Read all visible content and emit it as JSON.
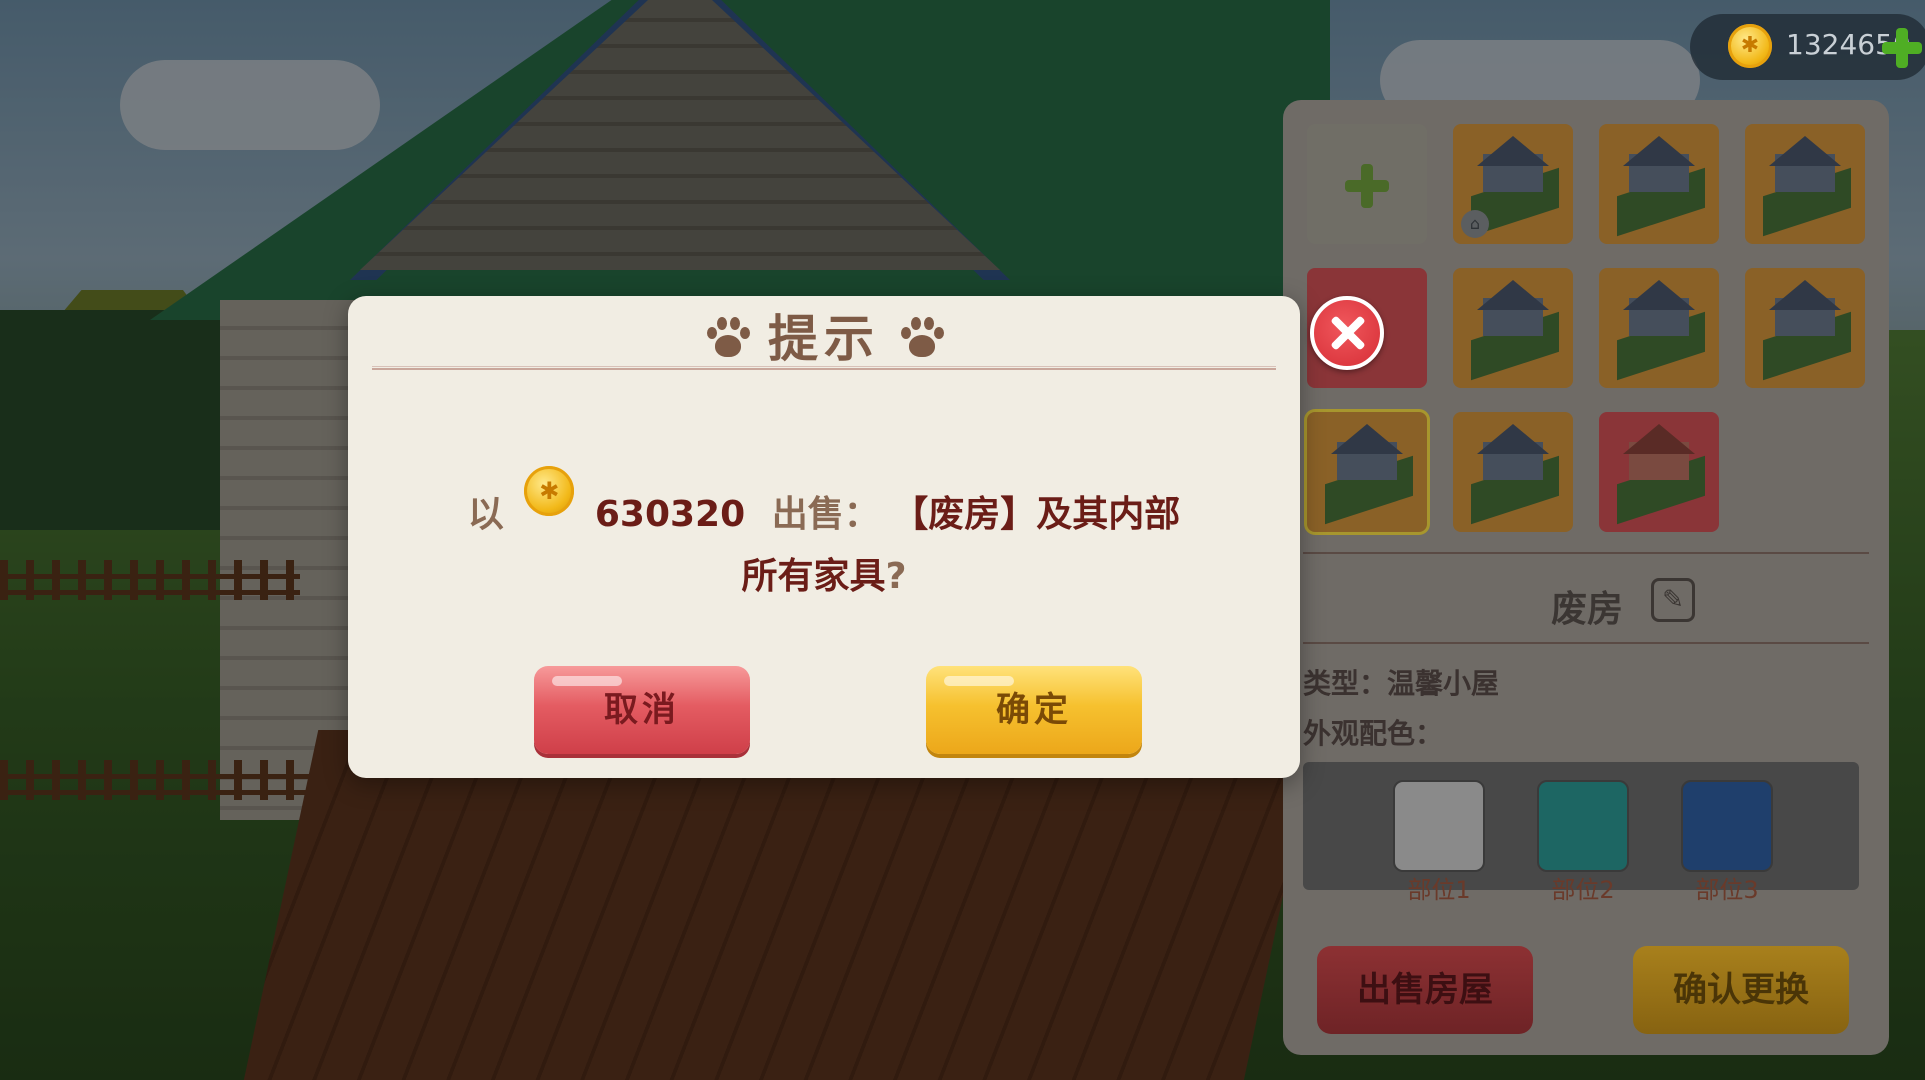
{
  "hud": {
    "coins": "1324650"
  },
  "panel": {
    "house_name": "废房",
    "type_label": "类型：",
    "type_value": "温馨小屋",
    "color_label": "外观配色：",
    "swatches": [
      {
        "label": "部位1",
        "color": "#cfcfcf"
      },
      {
        "label": "部位2",
        "color": "#2b9b95"
      },
      {
        "label": "部位3",
        "color": "#2e5ea5"
      }
    ],
    "sell_button": "出售房屋",
    "confirm_change_button": "确认更换"
  },
  "modal": {
    "title": "提示",
    "msg_prefix": "以",
    "price": "630320",
    "msg_sell": "出售：",
    "msg_target": "【废房】及其内部",
    "msg_line2": "所有家具",
    "msg_q": "?",
    "cancel": "取消",
    "confirm": "确定"
  }
}
